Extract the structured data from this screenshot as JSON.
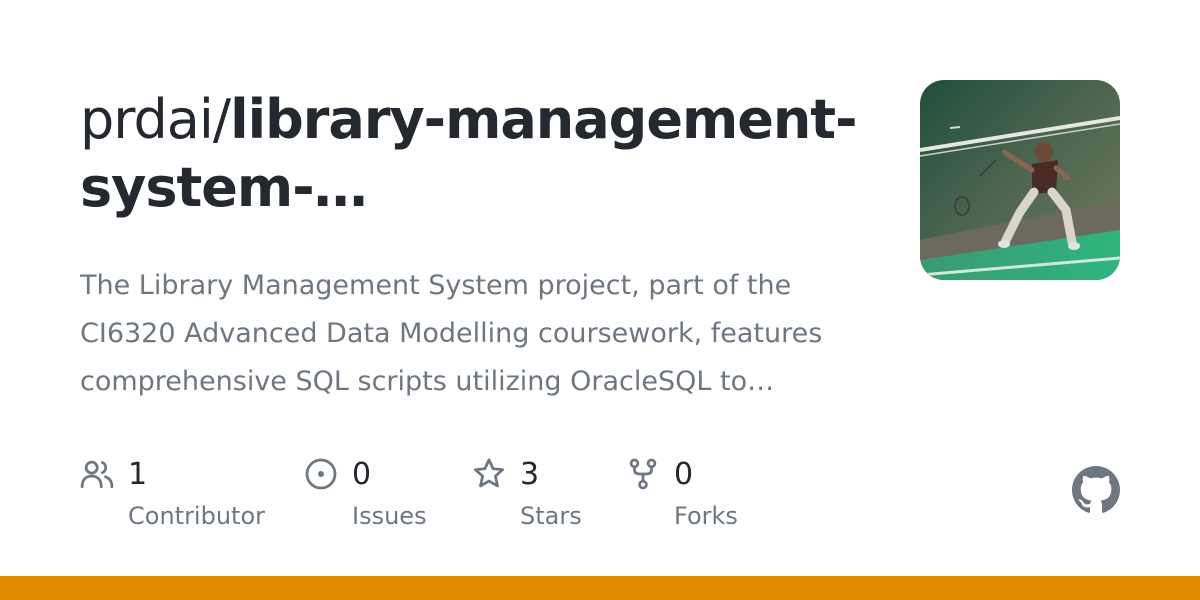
{
  "repo": {
    "owner_prefix": "prdai/",
    "name": "library-management-system-…",
    "description": "The Library Management System project, part of the CI6320 Advanced Data Modelling coursework, features comprehensive SQL scripts utilizing OracleSQL to…"
  },
  "stats": [
    {
      "icon": "people-icon",
      "count": "1",
      "label": "Contributor"
    },
    {
      "icon": "issue-icon",
      "count": "0",
      "label": "Issues"
    },
    {
      "icon": "star-icon",
      "count": "3",
      "label": "Stars"
    },
    {
      "icon": "fork-icon",
      "count": "0",
      "label": "Forks"
    }
  ],
  "colors": {
    "text_primary": "#24292f",
    "text_secondary": "#6e7781",
    "language_bar": "#e38c00",
    "logo": "#6e7781"
  },
  "brand_icon": "github-logo-icon",
  "avatar_icon": "owner-avatar"
}
